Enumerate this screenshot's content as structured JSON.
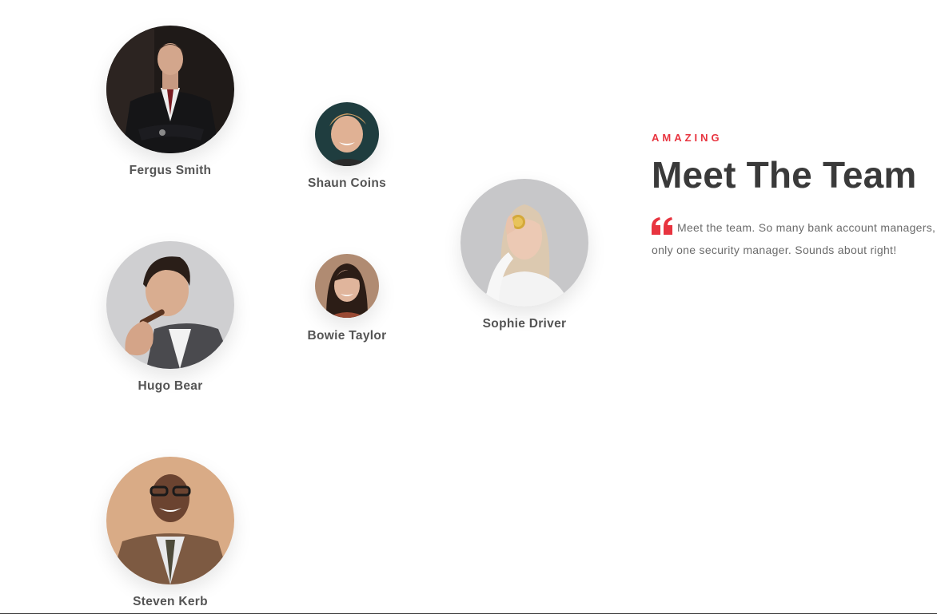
{
  "team": {
    "members": [
      {
        "name": "Fergus Smith"
      },
      {
        "name": "Shaun Coins"
      },
      {
        "name": "Hugo Bear"
      },
      {
        "name": "Bowie Taylor"
      },
      {
        "name": "Sophie Driver"
      },
      {
        "name": "Steven Kerb"
      }
    ]
  },
  "intro": {
    "eyebrow": "AMAZING",
    "title": "Meet The Team",
    "quote_icon": "quote-icon",
    "quote": "Meet the team. So many bank account managers, only one security manager. Sounds about right!"
  },
  "colors": {
    "accent": "#e8343f",
    "heading": "#3a3a3a",
    "body_text": "#6b6b6b",
    "name_text": "#555555"
  }
}
